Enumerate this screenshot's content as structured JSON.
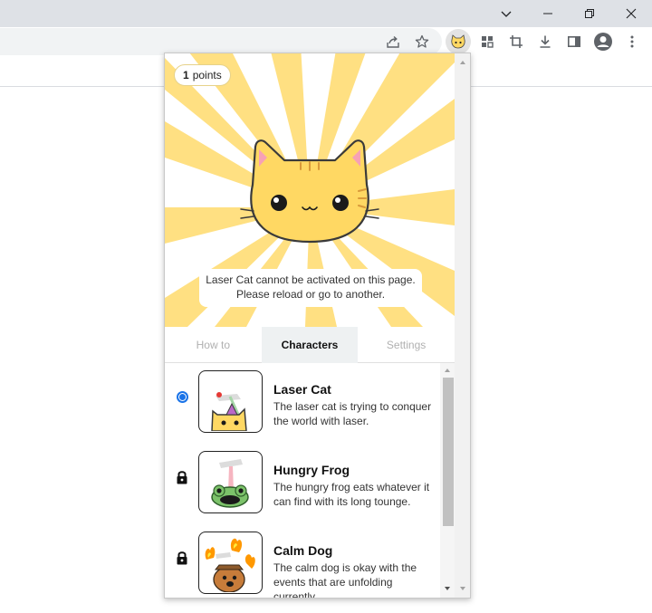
{
  "browser": {
    "window_controls": [
      "chevron-down-icon",
      "minimize-icon",
      "restore-icon",
      "close-icon"
    ],
    "toolbar_icons": [
      "share-icon",
      "star-icon",
      "laser-cat-extension-icon",
      "extensions-icon",
      "crop-icon",
      "download-icon",
      "side-panel-icon",
      "profile-icon",
      "more-vert-icon"
    ]
  },
  "popup": {
    "points": {
      "count": "1",
      "label": "points"
    },
    "notice": {
      "line1": "Laser Cat cannot be activated on this page.",
      "line2": "Please reload or go to another."
    },
    "tabs": [
      {
        "label": "How to",
        "active": false
      },
      {
        "label": "Characters",
        "active": true
      },
      {
        "label": "Settings",
        "active": false
      }
    ],
    "characters": [
      {
        "name": "Laser Cat",
        "description": "The laser cat is trying to conquer the world with laser.",
        "status": "selected"
      },
      {
        "name": "Hungry Frog",
        "description": "The hungry frog eats whatever it can find with its long tounge.",
        "status": "locked"
      },
      {
        "name": "Calm Dog",
        "description": "The calm dog is okay with the events that are unfolding currently.",
        "status": "locked"
      }
    ]
  },
  "colors": {
    "sunburst": "#ffe082",
    "cat_fill": "#ffd863",
    "accent_blue": "#1a73e8"
  }
}
